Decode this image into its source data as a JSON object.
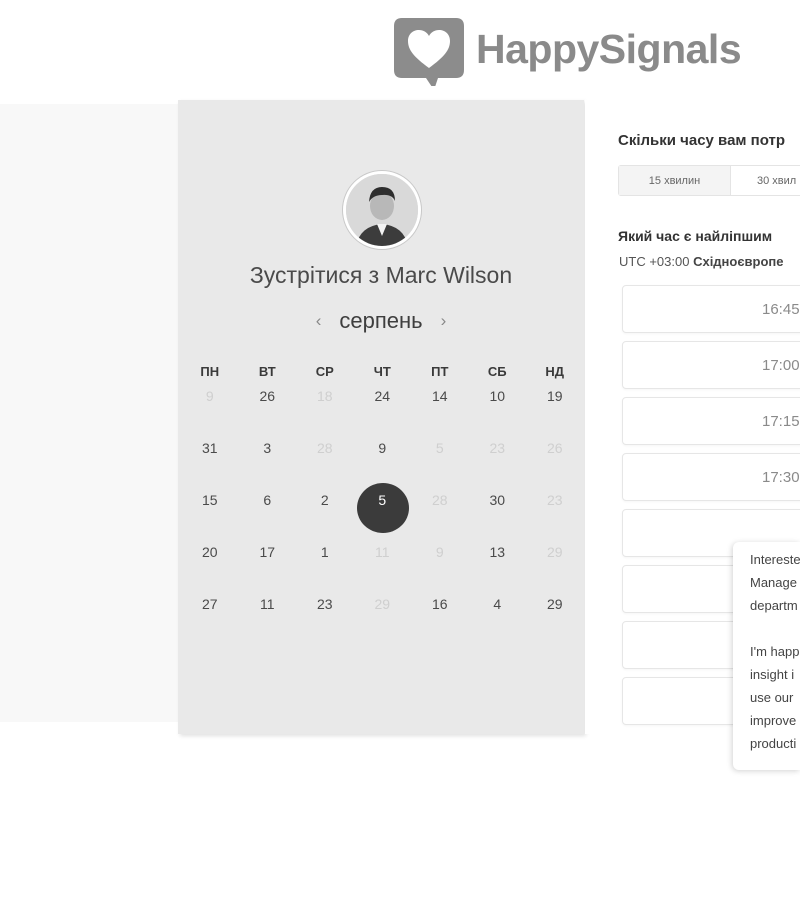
{
  "brand": {
    "name": "HappySignals"
  },
  "calendar": {
    "title": "Зустрітися з Marc Wilson",
    "month": "серпень",
    "prev_icon": "‹",
    "next_icon": "›",
    "weekdays": [
      "ПН",
      "ВТ",
      "СР",
      "ЧТ",
      "ПТ",
      "СБ",
      "НД"
    ],
    "weeks": [
      [
        {
          "d": "9",
          "muted": true
        },
        {
          "d": "26",
          "muted": false
        },
        {
          "d": "18",
          "muted": true
        },
        {
          "d": "24",
          "muted": false
        },
        {
          "d": "14",
          "muted": false
        },
        {
          "d": "10",
          "muted": false
        },
        {
          "d": "19",
          "muted": false
        }
      ],
      [
        {
          "d": "31",
          "muted": false
        },
        {
          "d": "3",
          "muted": false
        },
        {
          "d": "28",
          "muted": true
        },
        {
          "d": "9",
          "muted": false
        },
        {
          "d": "5",
          "muted": true
        },
        {
          "d": "23",
          "muted": true
        },
        {
          "d": "26",
          "muted": true
        }
      ],
      [
        {
          "d": "15",
          "muted": false
        },
        {
          "d": "6",
          "muted": false
        },
        {
          "d": "2",
          "muted": false
        },
        {
          "d": "5",
          "muted": false,
          "selected": true
        },
        {
          "d": "28",
          "muted": true
        },
        {
          "d": "30",
          "muted": false
        },
        {
          "d": "23",
          "muted": true
        }
      ],
      [
        {
          "d": "20",
          "muted": false
        },
        {
          "d": "17",
          "muted": false
        },
        {
          "d": "1",
          "muted": false
        },
        {
          "d": "11",
          "muted": true
        },
        {
          "d": "9",
          "muted": true
        },
        {
          "d": "13",
          "muted": false
        },
        {
          "d": "29",
          "muted": true
        }
      ],
      [
        {
          "d": "27",
          "muted": false
        },
        {
          "d": "11",
          "muted": false
        },
        {
          "d": "23",
          "muted": false
        },
        {
          "d": "29",
          "muted": true
        },
        {
          "d": "16",
          "muted": false
        },
        {
          "d": "4",
          "muted": false
        },
        {
          "d": "29",
          "muted": false
        }
      ]
    ]
  },
  "duration": {
    "question": "Скільки часу вам потр",
    "options": [
      "15 хвилин",
      "30 хвил"
    ]
  },
  "time": {
    "question": "Який час є найліпшим",
    "timezone_prefix": "UTC +03:00",
    "timezone_name": "Східноєвропе",
    "slots": [
      "16:45",
      "17:00",
      "17:15",
      "17:30",
      "",
      "",
      ""
    ]
  },
  "chat": {
    "lines": [
      "Intereste",
      "Manage",
      "departm",
      "I'm happ",
      "insight i",
      "use our",
      "improve",
      "producti"
    ]
  }
}
